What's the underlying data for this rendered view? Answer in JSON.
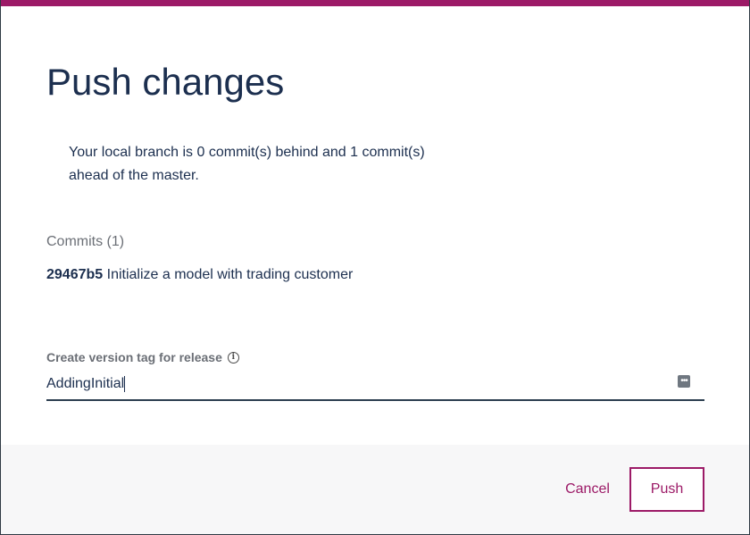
{
  "dialog": {
    "title": "Push changes",
    "summary": "Your local branch is 0 commit(s) behind and 1 commit(s) ahead of the master.",
    "commits_label": "Commits (1)",
    "commits": [
      {
        "hash": "29467b5",
        "message": "Initialize a model with trading customer"
      }
    ],
    "tag_field": {
      "label": "Create version tag for release",
      "value": "AddingInitial",
      "info_icon": "info-icon",
      "action_icon": "more-icon"
    },
    "buttons": {
      "cancel": "Cancel",
      "push": "Push"
    }
  },
  "colors": {
    "accent": "#9c1a67",
    "title": "#1c2f4f",
    "muted": "#6b6f76",
    "footer_bg": "#f7f7f8"
  }
}
